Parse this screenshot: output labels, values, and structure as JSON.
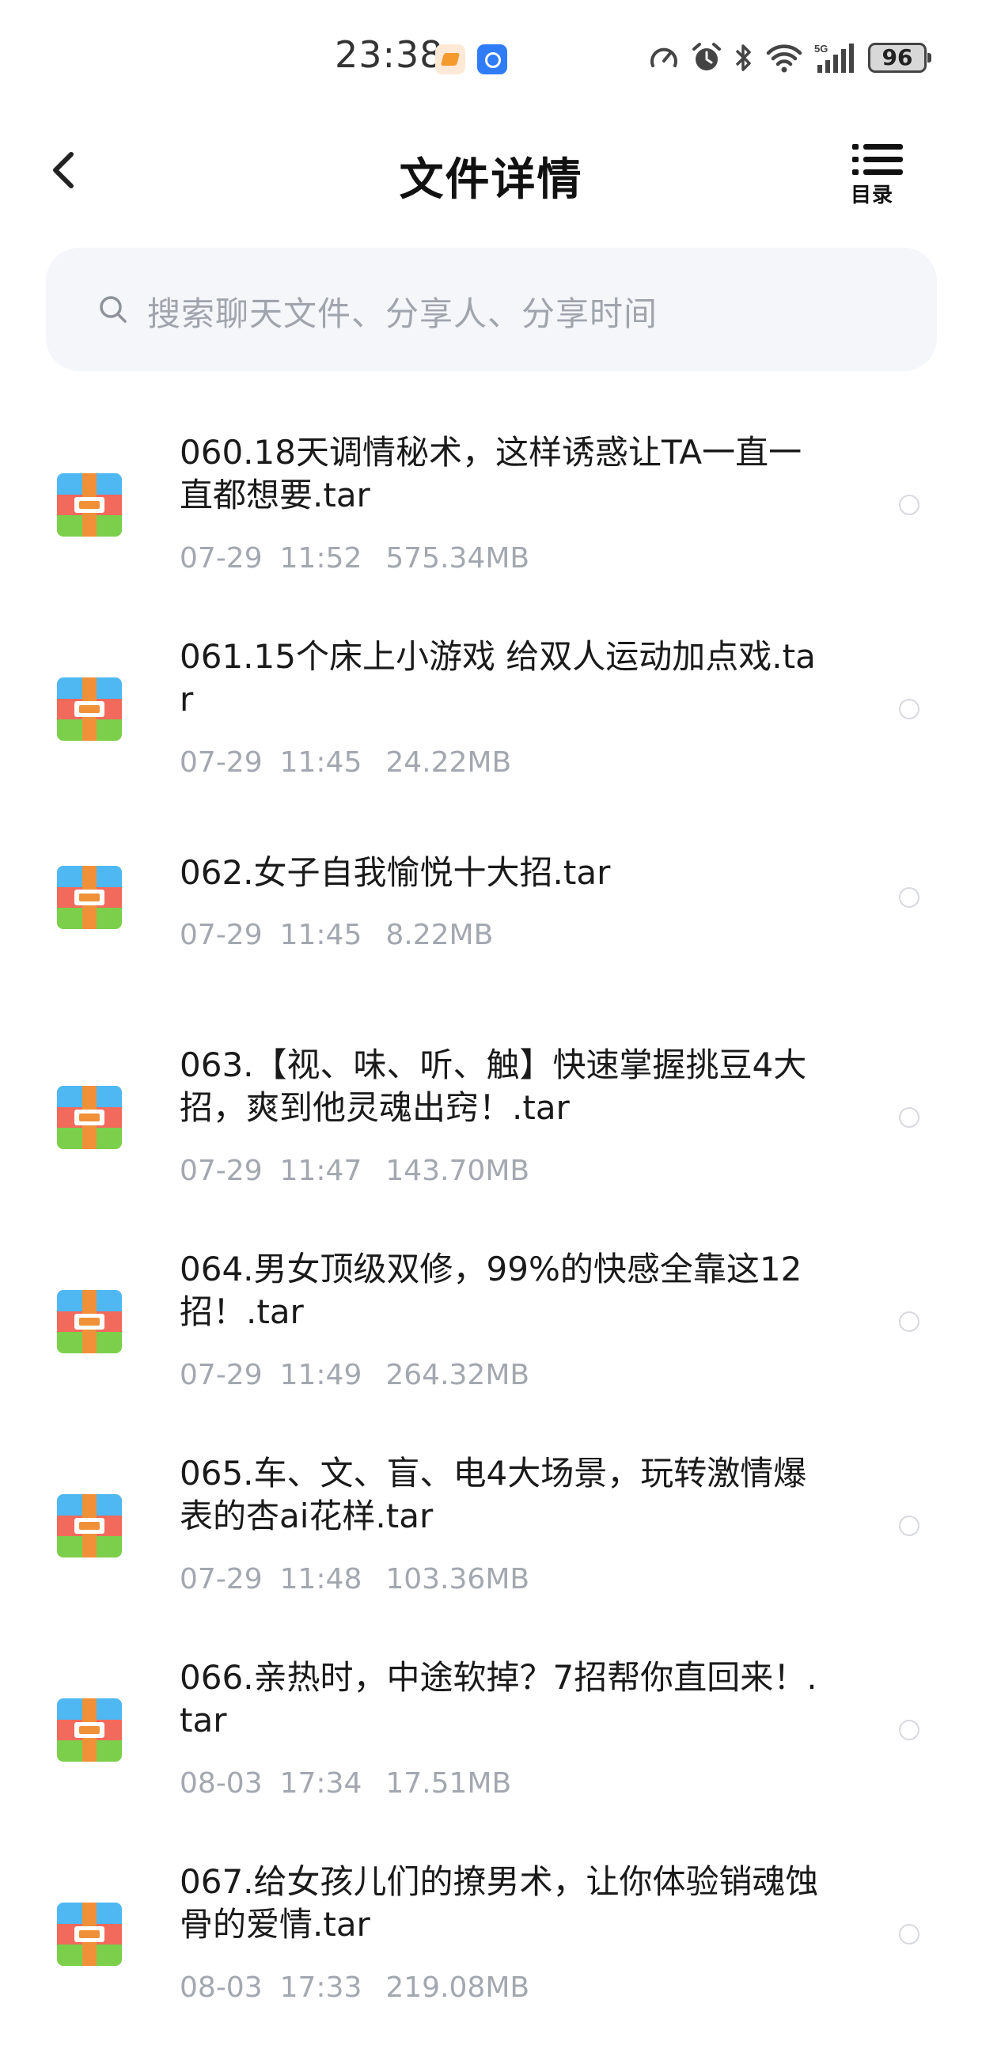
{
  "status_bar": {
    "time": "23:38",
    "network": "5G",
    "battery": "96"
  },
  "header": {
    "back_icon": "chevron-left-icon",
    "title": "文件详情",
    "toc_label": "目录",
    "toc_icon": "list-icon"
  },
  "search": {
    "placeholder": "搜索聊天文件、分享人、分享时间",
    "icon": "search-icon"
  },
  "colors": {
    "archive_blue": "#4fb8f2",
    "archive_red": "#f26a5c",
    "archive_green": "#7ccf4a",
    "archive_orange": "#f0913a",
    "meta_gray": "#a3a7b0"
  },
  "files": [
    {
      "name": "060.18天调情秘术，这样诱惑让TA一直一直都想要.tar",
      "date": "07-29",
      "time": "11:52",
      "size": "575.34MB"
    },
    {
      "name": "061.15个床上小游戏 给双人运动加点戏.tar",
      "date": "07-29",
      "time": "11:45",
      "size": "24.22MB"
    },
    {
      "name": "062.女子自我愉悦十大招.tar",
      "date": "07-29",
      "time": "11:45",
      "size": "8.22MB"
    },
    {
      "name": "063.【视、味、听、触】快速掌握挑豆4大招，爽到他灵魂出窍！.tar",
      "date": "07-29",
      "time": "11:47",
      "size": "143.70MB"
    },
    {
      "name": "064.男女顶级双修，99%的快感全靠这12招！.tar",
      "date": "07-29",
      "time": "11:49",
      "size": "264.32MB"
    },
    {
      "name": "065.车、文、盲、电4大场景，玩转激情爆表的杏ai花样.tar",
      "date": "07-29",
      "time": "11:48",
      "size": "103.36MB"
    },
    {
      "name": "066.亲热时，中途软掉？7招帮你直回来！.tar",
      "date": "08-03",
      "time": "17:34",
      "size": "17.51MB"
    },
    {
      "name": "067.给女孩儿们的撩男术，让你体验销魂蚀骨的爱情.tar",
      "date": "08-03",
      "time": "17:33",
      "size": "219.08MB"
    }
  ]
}
